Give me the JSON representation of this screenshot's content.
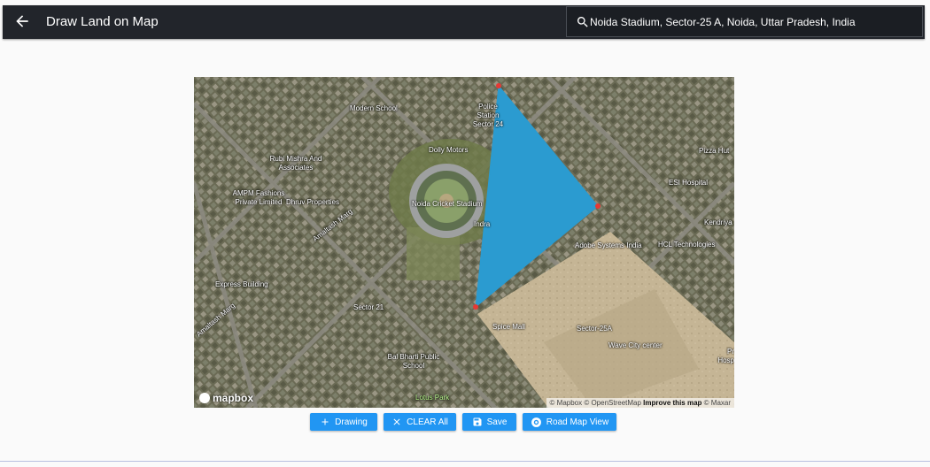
{
  "appbar": {
    "title": "Draw Land on Map",
    "search_value": "Noida Stadium, Sector-25 A, Noida, Uttar Pradesh, India"
  },
  "map": {
    "labels": [
      {
        "text": "Modern School"
      },
      {
        "text": "Police Station Sector 24"
      },
      {
        "text": "Dolly Motors"
      },
      {
        "text": "Rubi Mishra And Associates"
      },
      {
        "text": "AMPM Fashions Private Limited"
      },
      {
        "text": "Dhruv Properties"
      },
      {
        "text": "Noida Cricket Stadium"
      },
      {
        "text": "Indra"
      },
      {
        "text": "Amaltash Marg"
      },
      {
        "text": "Pizza Hut"
      },
      {
        "text": "ESI Hospital"
      },
      {
        "text": "Kendriya"
      },
      {
        "text": "Adobe Systems India"
      },
      {
        "text": "HCL Technologies"
      },
      {
        "text": "Express Building"
      },
      {
        "text": "Sector 21"
      },
      {
        "text": "Amaltash Marg"
      },
      {
        "text": "Spice Mall"
      },
      {
        "text": "Sector-25A"
      },
      {
        "text": "Wave City center"
      },
      {
        "text": "Bal Bharti Public School"
      },
      {
        "text": "Lotus Park"
      },
      {
        "text": "Pr Hosp"
      }
    ],
    "polygon_color": "#2b9bd0",
    "vertex_color": "#e53935",
    "logo": "mapbox",
    "attribution": {
      "mapbox": "© Mapbox",
      "osm": "© OpenStreetMap",
      "improve": "Improve this map",
      "maxar": "© Maxar"
    }
  },
  "buttons": {
    "drawing": "Drawing",
    "clear_all": "CLEAR All",
    "save": "Save",
    "road_map_view": "Road Map View"
  },
  "colors": {
    "appbar": "#22252b",
    "button": "#2196f3"
  },
  "icons": [
    "arrow-left-icon",
    "search-icon",
    "plus-icon",
    "close-icon",
    "save-icon",
    "map-view-icon"
  ]
}
